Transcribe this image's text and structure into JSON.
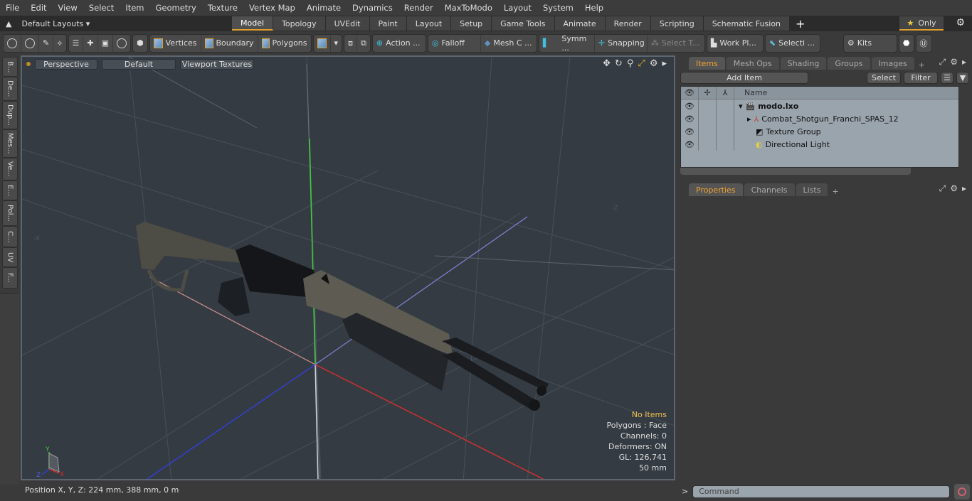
{
  "menu": [
    "File",
    "Edit",
    "View",
    "Select",
    "Item",
    "Geometry",
    "Texture",
    "Vertex Map",
    "Animate",
    "Dynamics",
    "Render",
    "MaxToModo",
    "Layout",
    "System",
    "Help"
  ],
  "layouts": {
    "label": "Default Layouts ▾"
  },
  "tabs": [
    "Model",
    "Topology",
    "UVEdit",
    "Paint",
    "Layout",
    "Setup",
    "Game Tools",
    "Animate",
    "Render",
    "Scripting",
    "Schematic Fusion"
  ],
  "active_tab": "Model",
  "only_label": "Only",
  "toolbar": {
    "vertices": "Vertices",
    "boundary": "Boundary",
    "polygons": "Polygons",
    "action": "Action ...",
    "falloff": "Falloff",
    "mesh": "Mesh C ...",
    "symm": "Symm ...",
    "snapping": "Snapping",
    "select_t": "Select T...",
    "workplane": "Work Pl...",
    "selecti": "Selecti ...",
    "kits": "Kits"
  },
  "left_tabs": [
    "B...",
    "De...",
    "Dup...",
    "Mes...",
    "Ve...",
    "E...",
    "Pol...",
    "C...",
    "UV",
    "F..."
  ],
  "viewport": {
    "perspective": "Perspective",
    "default": "Default",
    "textures": "Viewport Textures",
    "info": {
      "no_items": "No Items",
      "polygons": "Polygons : Face",
      "channels": "Channels: 0",
      "deformers": "Deformers: ON",
      "gl": "GL: 126,741",
      "scale": "50 mm"
    },
    "axis_labels": {
      "neg_x": "-X",
      "neg_z": "-Z",
      "x": "X",
      "y": "Y",
      "z": "Z"
    }
  },
  "status": {
    "position": "Position X, Y, Z:   224 mm, 388 mm, 0 m"
  },
  "items_panel": {
    "tabs": [
      "Items",
      "Mesh Ops",
      "Shading",
      "Groups",
      "Images"
    ],
    "add_item": "Add Item",
    "select": "Select",
    "filter": "Filter",
    "col_name": "Name",
    "rows": [
      {
        "name": "modo.lxo",
        "bold": true
      },
      {
        "name": "Combat_Shotgun_Franchi_SPAS_12"
      },
      {
        "name": "Texture Group"
      },
      {
        "name": "Directional Light"
      }
    ]
  },
  "props_panel": {
    "tabs": [
      "Properties",
      "Channels",
      "Lists"
    ]
  },
  "command": {
    "placeholder": "Command"
  }
}
